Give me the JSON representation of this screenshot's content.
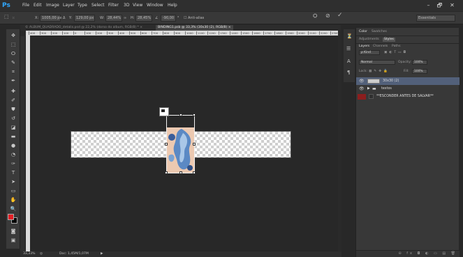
{
  "app": {
    "logo": "Ps"
  },
  "menu": [
    "File",
    "Edit",
    "Image",
    "Layer",
    "Type",
    "Select",
    "Filter",
    "3D",
    "View",
    "Window",
    "Help"
  ],
  "window_controls": {
    "minimize": "–",
    "maximize": "🗗",
    "close": "✕"
  },
  "options": {
    "x_label": "X:",
    "x_value": "1005,00 px",
    "y_label": "Y:",
    "y_value": "129,00 px",
    "w_label": "W:",
    "w_value": "28,44%",
    "h_label": "H:",
    "h_value": "28,45%",
    "angle_value": "-90,00",
    "h_skew_label": "H:",
    "v_skew_label": "V:",
    "antialias_label": "Anti-alias",
    "workspace": "Essentials"
  },
  "tabs": [
    {
      "label": "© ALBUM_QUADRADO_detalis.psd @ 22,2% (dorso do album, RGB/8) * ×",
      "active": false
    },
    {
      "label": "BINDING1.psb @ 33,3% (30x30 (2), RGB/8) ×",
      "active": true
    }
  ],
  "ruler_ticks": [
    "400",
    "300",
    "200",
    "100",
    "0",
    "100",
    "200",
    "300",
    "400",
    "500",
    "600",
    "700",
    "800",
    "900",
    "1000",
    "1100",
    "1200",
    "1300",
    "1400",
    "1500",
    "1600",
    "1700",
    "1800",
    "1900",
    "2000",
    "2100",
    "2200",
    "2300"
  ],
  "status": {
    "zoom": "33,33%",
    "doc": "Doc: 1,45M/1,07M"
  },
  "panels": {
    "top_tabs": [
      "Color",
      "Swatches"
    ],
    "mid_tabs": [
      "Adjustments",
      "Styles"
    ],
    "layer_tabs": [
      "Layers",
      "Channels",
      "Paths"
    ],
    "kind_label": "ρ Kind",
    "blend_mode": "Normal",
    "opacity_label": "Opacity:",
    "opacity_value": "100%",
    "lock_label": "Lock:",
    "fill_label": "Fill:",
    "fill_value": "100%",
    "layers": [
      {
        "name": "30x30 (2)",
        "selected": true,
        "type": "smart-object"
      },
      {
        "name": "textos",
        "selected": false,
        "type": "group"
      },
      {
        "name": "**ESCONDER ANTES DE SALVAR**",
        "selected": false,
        "type": "color-fill"
      }
    ],
    "footer_icons": "⊖ fx ◘ ◐ ▭ ▤ 🗑"
  },
  "colors": {
    "foreground": "#e31e24",
    "background": "#000000",
    "accent": "#31a8ff"
  }
}
